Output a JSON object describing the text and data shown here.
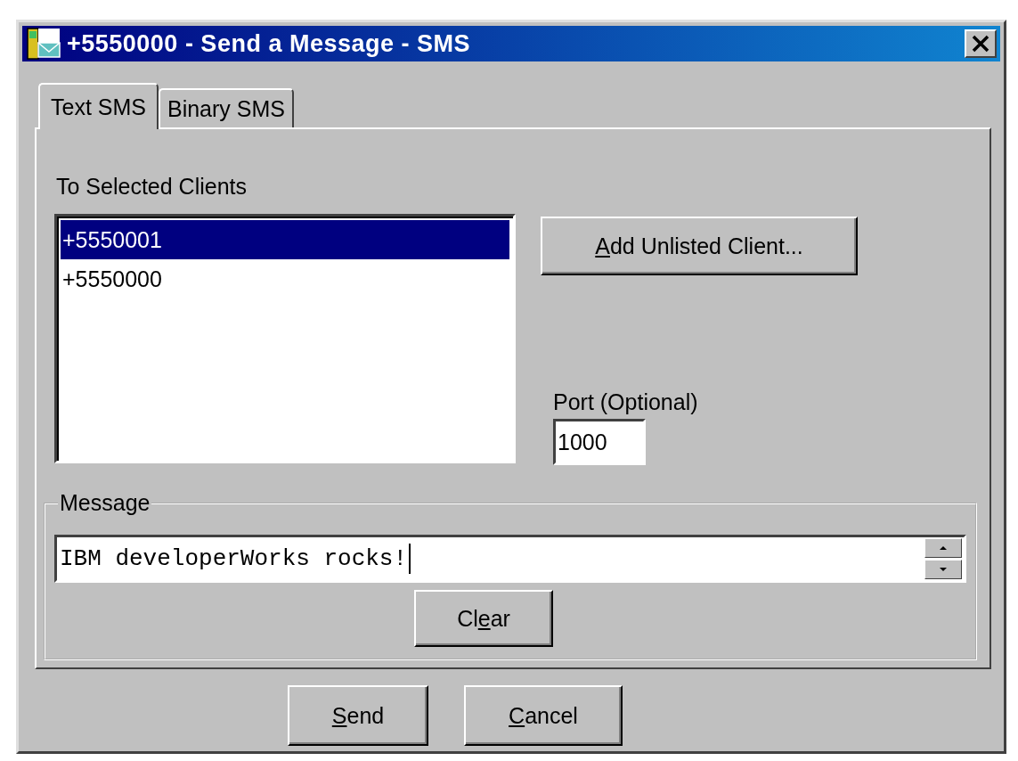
{
  "window": {
    "title": "+5550000 - Send a Message - SMS"
  },
  "tabs": [
    {
      "label": "Text SMS",
      "selected": true
    },
    {
      "label": "Binary SMS",
      "selected": false
    }
  ],
  "clients": {
    "label": "To Selected Clients",
    "items": [
      {
        "label": "+5550001",
        "selected": true
      },
      {
        "label": "+5550000",
        "selected": false
      }
    ]
  },
  "add_button": {
    "key": "A",
    "rest": "dd Unlisted Client..."
  },
  "port": {
    "label": "Port (Optional)",
    "value": "1000"
  },
  "message": {
    "label": "Message",
    "value": "IBM developerWorks rocks!"
  },
  "clear_button": {
    "pre": "Cl",
    "key": "e",
    "rest": "ar"
  },
  "buttons": [
    {
      "key": "S",
      "rest": "end"
    },
    {
      "key": "C",
      "rest": "ancel"
    }
  ]
}
